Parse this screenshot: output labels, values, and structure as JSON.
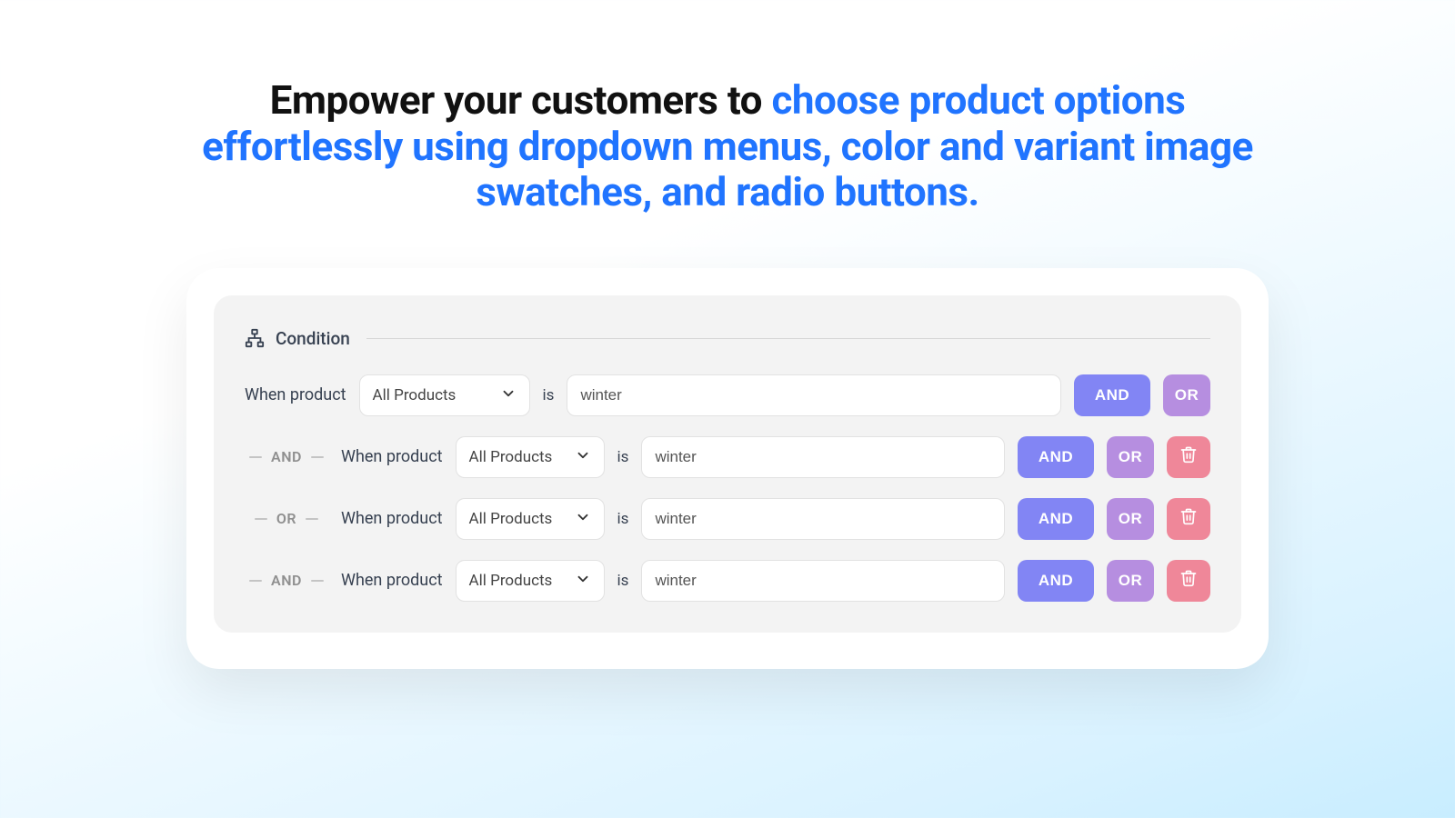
{
  "headline_part1": "Empower your customers to ",
  "headline_part2": "choose product options effortlessly using dropdown menus, color and variant image swatches, and radio buttons.",
  "condition": {
    "title": "Condition",
    "rows": [
      {
        "chain": "",
        "when": "When product",
        "select": "All Products",
        "is": "is",
        "value": "winter",
        "and": "AND",
        "or": "OR"
      },
      {
        "chain": "AND",
        "when": "When product",
        "select": "All Products",
        "is": "is",
        "value": "winter",
        "and": "AND",
        "or": "OR"
      },
      {
        "chain": "OR",
        "when": "When product",
        "select": "All Products",
        "is": "is",
        "value": "winter",
        "and": "AND",
        "or": "OR"
      },
      {
        "chain": "AND",
        "when": "When product",
        "select": "All Products",
        "is": "is",
        "value": "winter",
        "and": "AND",
        "or": "OR"
      }
    ]
  }
}
